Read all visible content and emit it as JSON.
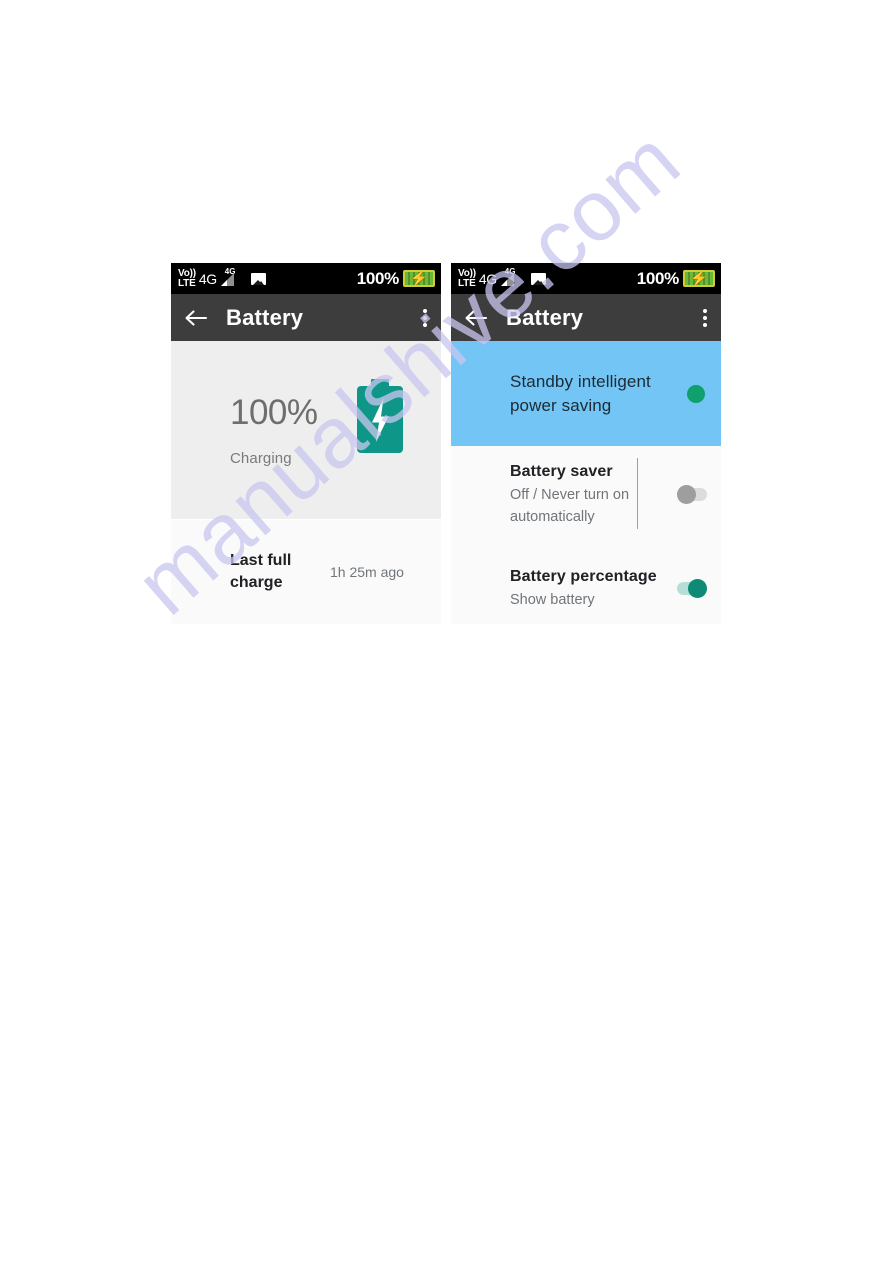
{
  "page": {
    "watermark": "manualshive.com",
    "background_color": "#ffffff"
  },
  "colors": {
    "statusbar_bg": "#000000",
    "appbar_bg": "#3d3d3d",
    "hero_bg": "#eeeeee",
    "list_bg": "#fafafa",
    "highlight_blue": "#72c5f4",
    "battery_teal": "#0e9688",
    "toggle_on_green": "#0e8a77",
    "toggle_dot_green": "#0fa06b",
    "toggle_off_gray": "#9e9e9e",
    "status_battery_green": "#5fa832",
    "status_bolt_red": "#e03a1c"
  },
  "statusbar": {
    "volte_line1": "Vo))",
    "volte_line2": "LTE",
    "network": "4G",
    "signal_superscript": "4G",
    "signal_icon": "signal-bars-icon",
    "photo_icon": "screenshot-photo-icon",
    "battery_percent": "100%",
    "battery_icon": "battery-charging-icon",
    "battery_bolt": "⚡"
  },
  "appbar": {
    "back_icon": "back-arrow-icon",
    "title": "Battery",
    "overflow_icon": "overflow-menu-icon"
  },
  "screens": [
    {
      "id": "battery-overview",
      "hero": {
        "percent": "100%",
        "state": "Charging",
        "battery_icon": "battery-charging-bolt-icon"
      },
      "rows": [
        {
          "name": "last-full-charge",
          "title": "Last full charge",
          "value": "1h 25m ago"
        }
      ]
    },
    {
      "id": "battery-settings",
      "rows": [
        {
          "name": "standby-intelligent-power-saving",
          "title": "Standby intelligent power saving",
          "subtitle": "",
          "toggle": "on",
          "highlighted": true
        },
        {
          "name": "battery-saver",
          "title": "Battery saver",
          "subtitle": "Off / Never turn on automatically",
          "toggle": "off",
          "highlighted": false
        },
        {
          "name": "battery-percentage",
          "title": "Battery percentage",
          "subtitle": "Show battery",
          "toggle": "on",
          "highlighted": false
        }
      ]
    }
  ]
}
